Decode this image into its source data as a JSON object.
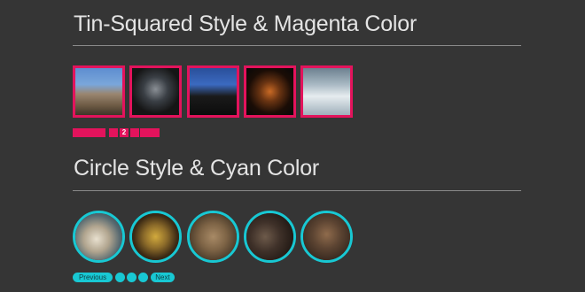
{
  "sections": {
    "squared": {
      "title": "Tin-Squared Style & Magenta Color",
      "accent": "#e3135c",
      "thumbnails": [
        "city-aerial",
        "interior-dark",
        "cathedral-spires",
        "night-arch",
        "modern-building"
      ],
      "pager": {
        "previous_label": "",
        "pages": [
          "",
          "2",
          ""
        ],
        "current": "2",
        "next_label": ""
      }
    },
    "circle": {
      "title": "Circle Style & Cyan Color",
      "accent": "#18c8d3",
      "thumbnails": [
        "vintage-van",
        "wine-bottles",
        "stone-wall",
        "bicycle",
        "vehicles-street"
      ],
      "pager": {
        "previous_label": "Previous",
        "pages": [
          "",
          "",
          ""
        ],
        "next_label": "Next"
      }
    }
  }
}
